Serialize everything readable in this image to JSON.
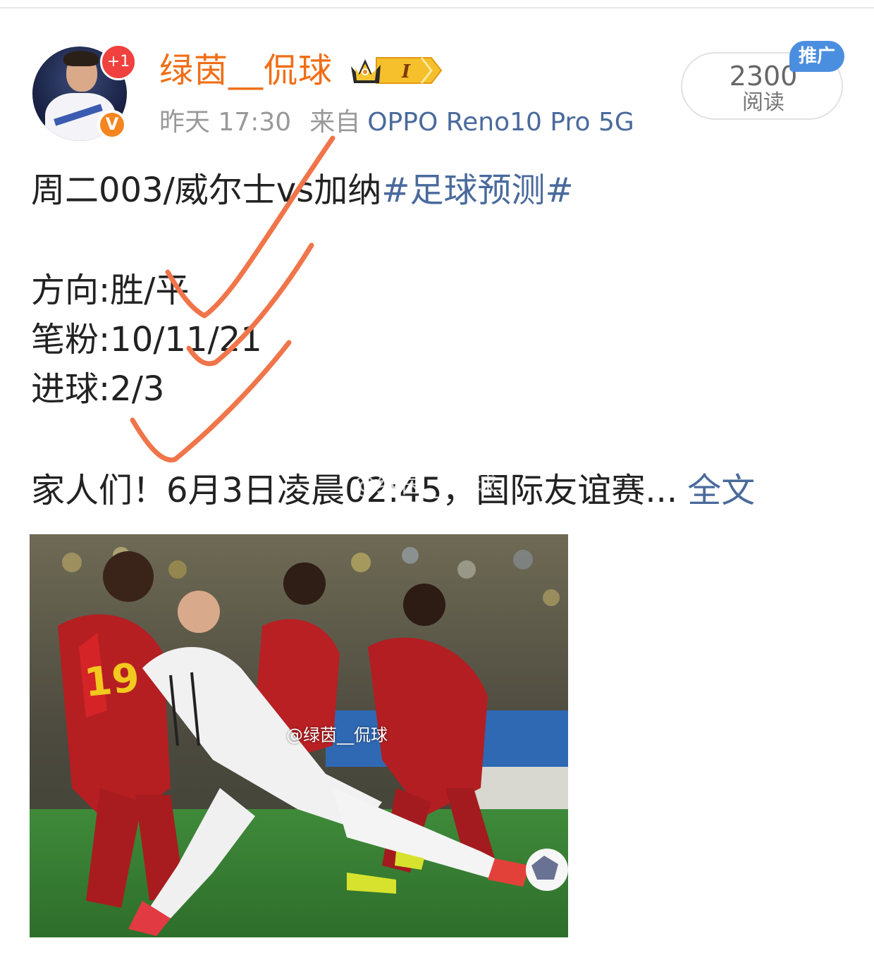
{
  "post": {
    "author": {
      "username": "绿茵__侃球",
      "avatar_badge": "+1",
      "verified_badge": "V",
      "vip_level": "I",
      "icons": [
        "avatar-photo",
        "crown-icon",
        "verified-v-icon"
      ]
    },
    "meta": {
      "time": "昨天 17:30",
      "source_label": "来自",
      "device": "OPPO Reno10 Pro 5G"
    },
    "reads": {
      "count": "2300",
      "label": "阅读",
      "promo_tag": "推广"
    },
    "body": {
      "title": "周二003/威尔士vs加纳",
      "hashtag": "#足球预测#",
      "direction": "方向:胜/平",
      "pen": "笔粉:10/11/21",
      "goals": "进球:2/3",
      "family": "家人们！6月3日凌晨02:45，国际友谊赛...",
      "fulltext_link": "全文",
      "watermark": "@绿茵__侃球"
    },
    "image": {
      "watermark": "@绿茵__侃球",
      "jersey_number": "19"
    },
    "colors": {
      "username": "#f06e15",
      "link": "#4a6a9c",
      "annotation": "#f0754a",
      "promo": "#4a8ee0"
    }
  }
}
